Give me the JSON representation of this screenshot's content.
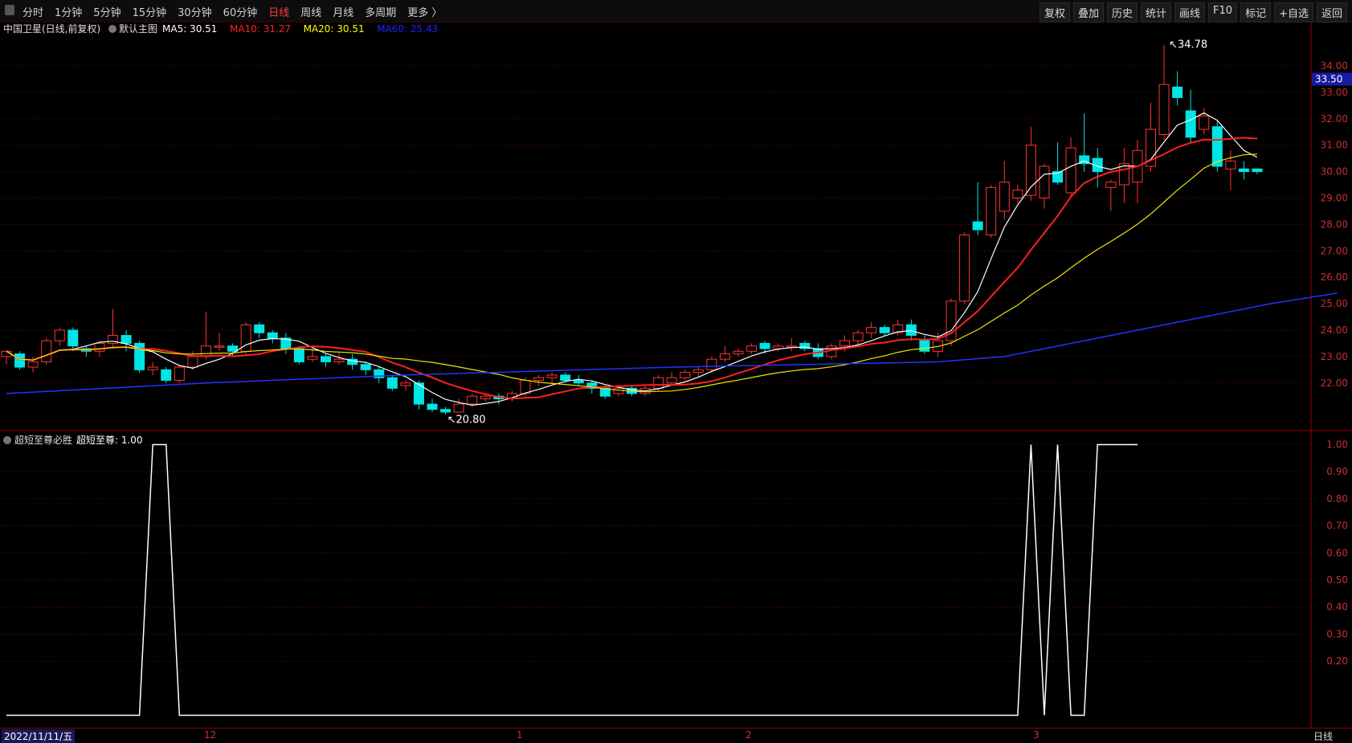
{
  "toolbar": {
    "periods": [
      "分时",
      "1分钟",
      "5分钟",
      "15分钟",
      "30分钟",
      "60分钟",
      "日线",
      "周线",
      "月线",
      "多周期",
      "更多 〉"
    ],
    "active_period": "日线",
    "tools": [
      "复权",
      "叠加",
      "历史",
      "统计",
      "画线",
      "F10",
      "标记",
      "+自选",
      "返回"
    ]
  },
  "main_header": {
    "title": "中国卫星(日线,前复权)",
    "indicator": "默认主图",
    "ma": [
      {
        "label": "MA5: 30.51",
        "color": "#ffffff"
      },
      {
        "label": "MA10: 31.27",
        "color": "#ff2020"
      },
      {
        "label": "MA20: 30.51",
        "color": "#ffff00"
      },
      {
        "label": "MA60: 25.43",
        "color": "#2020ff"
      }
    ]
  },
  "sub_header": {
    "title": "超短至尊必胜",
    "value": "超短至尊: 1.00"
  },
  "bottom": {
    "date": "2022/11/11/五",
    "month_ticks": [
      "12",
      "1",
      "2",
      "3"
    ],
    "period": "日线"
  },
  "colors": {
    "up": "#ff3333",
    "down": "#00e5e5",
    "ma5": "#ffffff",
    "ma10": "#ff2020",
    "ma20": "#e8e800",
    "ma60": "#2233ff",
    "grid": "#5a0000"
  },
  "chart_data": [
    {
      "type": "candlestick",
      "title": "中国卫星(日线,前复权)",
      "y_ticks": [
        22.0,
        23.0,
        24.0,
        25.0,
        26.0,
        27.0,
        28.0,
        29.0,
        30.0,
        31.0,
        32.0,
        33.0,
        34.0
      ],
      "ylim": [
        20.2,
        35.4
      ],
      "current_price": 33.5,
      "annotations": [
        {
          "label": "34.78",
          "type": "high"
        },
        {
          "label": "20.80",
          "type": "low"
        }
      ],
      "candles": [
        [
          23.0,
          23.2,
          22.7,
          23.1
        ],
        [
          23.1,
          22.6,
          22.5,
          23.2
        ],
        [
          22.6,
          22.8,
          22.4,
          23.0
        ],
        [
          22.8,
          23.6,
          22.7,
          23.7
        ],
        [
          23.6,
          24.0,
          23.4,
          24.1
        ],
        [
          24.0,
          23.4,
          23.2,
          24.1
        ],
        [
          23.3,
          23.2,
          23.0,
          23.4
        ],
        [
          23.2,
          23.5,
          23.0,
          23.6
        ],
        [
          23.5,
          23.8,
          23.3,
          24.8
        ],
        [
          23.8,
          23.5,
          23.2,
          24.0
        ],
        [
          23.5,
          22.5,
          22.4,
          23.6
        ],
        [
          22.5,
          22.6,
          22.3,
          22.8
        ],
        [
          22.5,
          22.1,
          22.0,
          22.6
        ],
        [
          22.1,
          22.6,
          22.0,
          22.7
        ],
        [
          22.6,
          23.0,
          22.5,
          23.2
        ],
        [
          23.0,
          23.4,
          22.9,
          24.7
        ],
        [
          23.4,
          23.4,
          23.2,
          23.9
        ],
        [
          23.4,
          23.2,
          23.0,
          23.5
        ],
        [
          23.2,
          24.2,
          23.1,
          24.3
        ],
        [
          24.2,
          23.9,
          23.7,
          24.3
        ],
        [
          23.9,
          23.7,
          23.5,
          24.0
        ],
        [
          23.7,
          23.3,
          23.1,
          23.9
        ],
        [
          23.3,
          22.8,
          22.7,
          23.4
        ],
        [
          22.9,
          23.0,
          22.8,
          23.3
        ],
        [
          23.0,
          22.8,
          22.6,
          23.1
        ],
        [
          22.8,
          22.9,
          22.7,
          23.2
        ],
        [
          22.9,
          22.7,
          22.5,
          23.1
        ],
        [
          22.7,
          22.5,
          22.3,
          22.8
        ],
        [
          22.5,
          22.2,
          22.0,
          22.6
        ],
        [
          22.2,
          21.8,
          21.7,
          22.3
        ],
        [
          21.9,
          22.0,
          21.7,
          22.1
        ],
        [
          22.0,
          21.2,
          21.0,
          22.1
        ],
        [
          21.2,
          21.0,
          20.9,
          21.4
        ],
        [
          21.0,
          20.9,
          20.8,
          21.1
        ],
        [
          20.9,
          21.2,
          20.9,
          21.4
        ],
        [
          21.2,
          21.5,
          21.1,
          21.6
        ],
        [
          21.4,
          21.5,
          21.3,
          21.6
        ],
        [
          21.5,
          21.4,
          21.2,
          21.6
        ],
        [
          21.4,
          21.6,
          21.3,
          21.7
        ],
        [
          21.6,
          22.1,
          21.5,
          22.2
        ],
        [
          22.1,
          22.2,
          21.9,
          22.3
        ],
        [
          22.2,
          22.3,
          22.0,
          22.4
        ],
        [
          22.3,
          22.1,
          22.0,
          22.4
        ],
        [
          22.1,
          22.0,
          21.9,
          22.3
        ],
        [
          22.0,
          21.8,
          21.6,
          22.1
        ],
        [
          21.8,
          21.5,
          21.4,
          21.9
        ],
        [
          21.6,
          21.8,
          21.5,
          21.9
        ],
        [
          21.8,
          21.6,
          21.5,
          21.9
        ],
        [
          21.6,
          21.8,
          21.5,
          21.9
        ],
        [
          21.8,
          22.2,
          21.7,
          22.3
        ],
        [
          22.0,
          22.2,
          21.9,
          22.4
        ],
        [
          22.2,
          22.4,
          22.1,
          22.5
        ],
        [
          22.4,
          22.5,
          22.2,
          22.6
        ],
        [
          22.5,
          22.9,
          22.4,
          23.0
        ],
        [
          22.9,
          23.1,
          22.8,
          23.4
        ],
        [
          23.1,
          23.2,
          23.0,
          23.3
        ],
        [
          23.2,
          23.4,
          23.1,
          23.5
        ],
        [
          23.5,
          23.3,
          23.1,
          23.6
        ],
        [
          23.3,
          23.4,
          23.2,
          23.5
        ],
        [
          23.4,
          23.4,
          23.2,
          23.7
        ],
        [
          23.5,
          23.3,
          23.2,
          23.6
        ],
        [
          23.3,
          23.0,
          22.9,
          23.5
        ],
        [
          23.0,
          23.4,
          22.9,
          23.5
        ],
        [
          23.4,
          23.6,
          23.2,
          23.8
        ],
        [
          23.6,
          23.9,
          23.4,
          24.0
        ],
        [
          23.9,
          24.1,
          23.7,
          24.3
        ],
        [
          24.1,
          23.9,
          23.8,
          24.2
        ],
        [
          23.9,
          24.2,
          23.8,
          24.4
        ],
        [
          24.2,
          23.8,
          23.6,
          24.4
        ],
        [
          23.6,
          23.2,
          23.1,
          23.8
        ],
        [
          23.2,
          23.6,
          23.0,
          23.9
        ],
        [
          23.6,
          25.1,
          23.4,
          25.2
        ],
        [
          25.1,
          27.6,
          25.0,
          27.7
        ],
        [
          28.1,
          27.8,
          27.6,
          29.6
        ],
        [
          27.6,
          29.4,
          27.5,
          29.5
        ],
        [
          28.5,
          29.6,
          28.2,
          30.4
        ],
        [
          29.0,
          29.3,
          28.8,
          29.5
        ],
        [
          29.1,
          31.0,
          28.9,
          31.7
        ],
        [
          29.0,
          30.2,
          28.6,
          30.3
        ],
        [
          30.0,
          29.6,
          29.5,
          31.1
        ],
        [
          29.2,
          30.9,
          29.0,
          31.3
        ],
        [
          30.6,
          30.3,
          30.0,
          32.2
        ],
        [
          30.5,
          30.0,
          29.4,
          30.9
        ],
        [
          29.4,
          29.6,
          28.5,
          29.7
        ],
        [
          29.5,
          30.3,
          28.8,
          30.9
        ],
        [
          29.6,
          30.8,
          28.8,
          31.2
        ],
        [
          30.2,
          31.6,
          30.0,
          32.6
        ],
        [
          31.4,
          33.3,
          31.2,
          34.8
        ],
        [
          33.2,
          32.8,
          32.5,
          33.8
        ],
        [
          32.3,
          31.3,
          31.1,
          33.1
        ],
        [
          31.6,
          32.1,
          31.4,
          32.4
        ],
        [
          31.7,
          30.2,
          30.0,
          31.9
        ],
        [
          30.1,
          30.4,
          29.3,
          30.8
        ],
        [
          30.1,
          30.0,
          29.7,
          30.4
        ],
        [
          30.1,
          30.0,
          29.9,
          30.1
        ]
      ],
      "ma60": [
        [
          0,
          21.6
        ],
        [
          15,
          22.0
        ],
        [
          30,
          22.3
        ],
        [
          50,
          22.6
        ],
        [
          70,
          22.8
        ],
        [
          75,
          23.0
        ],
        [
          85,
          24.0
        ],
        [
          95,
          25.0
        ],
        [
          100,
          25.4
        ]
      ]
    },
    {
      "type": "line",
      "title": "超短至尊必胜",
      "series_label": "超短至尊",
      "y_ticks": [
        0.2,
        0.3,
        0.4,
        0.5,
        0.6,
        0.7,
        0.8,
        0.9,
        1.0
      ],
      "ylim": [
        -0.04,
        1.04
      ],
      "steps": [
        [
          0,
          0
        ],
        [
          10,
          0
        ],
        [
          11,
          1
        ],
        [
          12,
          1
        ],
        [
          13,
          0
        ],
        [
          76,
          0
        ],
        [
          77,
          1
        ],
        [
          78,
          0
        ],
        [
          79,
          1
        ],
        [
          80,
          0
        ],
        [
          81,
          0
        ],
        [
          82,
          1
        ],
        [
          85,
          1
        ]
      ]
    }
  ]
}
